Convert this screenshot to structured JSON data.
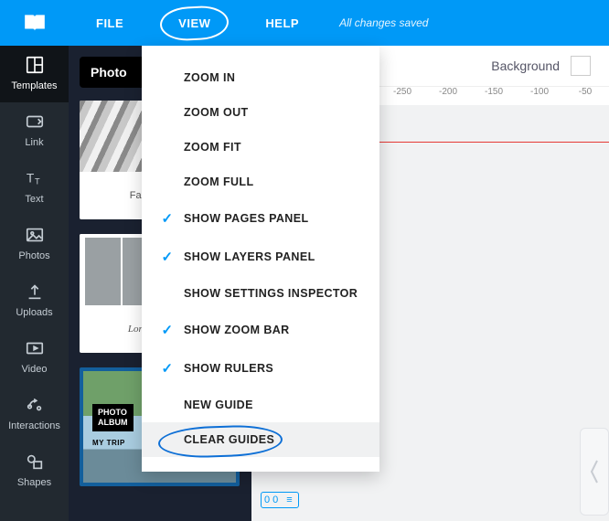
{
  "topbar": {
    "file": "FILE",
    "view": "VIEW",
    "help": "HELP",
    "saved": "All changes saved"
  },
  "sidebar": {
    "templates": "Templates",
    "link": "Link",
    "text": "Text",
    "photos": "Photos",
    "uploads": "Uploads",
    "video": "Video",
    "interactions": "Interactions",
    "shapes": "Shapes"
  },
  "panel": {
    "heading": "Photo",
    "tmpl1_caption": "Family album",
    "tmpl2_caption": "Lorem & Ipsum",
    "tmpl3_label_l1": "PHOTO",
    "tmpl3_label_l2": "ALBUM",
    "tmpl3_sub": "MY TRIP"
  },
  "workspace": {
    "background_label": "Background",
    "ruler": [
      "-250",
      "-200",
      "-150",
      "-100",
      "-50"
    ],
    "page_marker": "00 ≡"
  },
  "viewMenu": {
    "zoom_in": "ZOOM IN",
    "zoom_out": "ZOOM OUT",
    "zoom_fit": "ZOOM FIT",
    "zoom_full": "ZOOM FULL",
    "show_pages": "SHOW PAGES PANEL",
    "show_layers": "SHOW LAYERS PANEL",
    "show_settings": "SHOW SETTINGS INSPECTOR",
    "show_zoom_bar": "SHOW ZOOM BAR",
    "show_rulers": "SHOW RULERS",
    "new_guide": "NEW GUIDE",
    "clear_guides": "CLEAR GUIDES"
  }
}
